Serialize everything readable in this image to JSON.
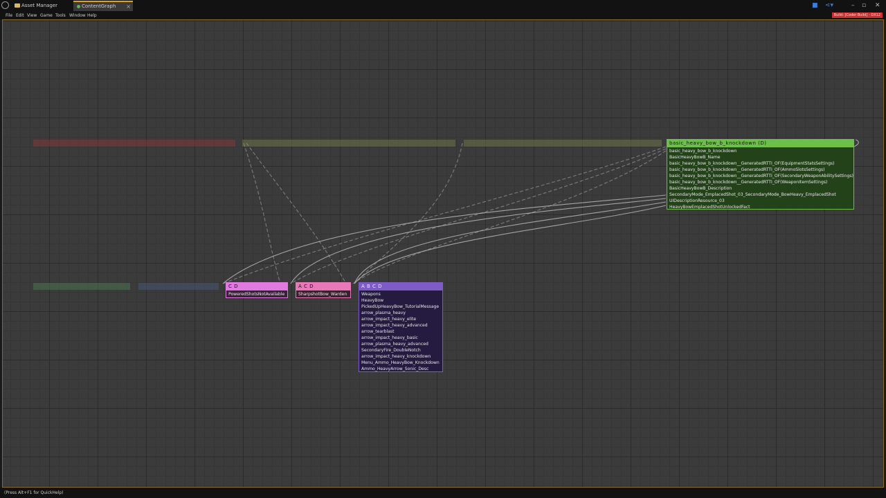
{
  "tabs": [
    {
      "label": "Asset Manager",
      "icon": "folder-icon"
    },
    {
      "label": "ContentGraph",
      "icon": "graph-icon",
      "active": true
    }
  ],
  "menu": [
    "File",
    "Edit",
    "View",
    "Game",
    "Tools",
    "Window",
    "Help"
  ],
  "build_badge": "Build: [Coder Build] - DX12",
  "nodes": {
    "bow": {
      "title": "basic_heavy_bow_b_knockdown (D)",
      "color": "#6cc04a",
      "items": [
        "basic_heavy_bow_b_knockdown",
        "BasicHeavyBowB_Name",
        "basic_heavy_bow_b_knockdown__GeneratedRTTI_OF(EquipmentStatsSettings)",
        "basic_heavy_bow_b_knockdown__GeneratedRTTI_OF(AmmoSlotsSettings)",
        "basic_heavy_bow_b_knockdown__GeneratedRTTI_OF(SecondaryWeaponAbilitySettings)",
        "basic_heavy_bow_b_knockdown__GeneratedRTTI_OF(WeaponItemSettings)",
        "BasicHeavyBowB_Description",
        "SecondaryMode_EmplacedShot_03_SecondaryMode_BowHeavy_EmplacedShot",
        "UIDescriptionResource_03",
        "HeavyBowEmplacedShotUnlockedFact"
      ]
    },
    "cd": {
      "title": "C D",
      "color": "#e07ae0",
      "items": [
        "PoweredShotsNotAvailable"
      ]
    },
    "acd": {
      "title": "A C D",
      "color": "#e878b8",
      "items": [
        "SharpshotBow_Warden"
      ]
    },
    "abcd": {
      "title": "A B C D",
      "color": "#7e5cc8",
      "items": [
        "Weapons",
        "HeavyBow",
        "PickedUpHeavyBow_TutorialMessage",
        "arrow_plasma_heavy",
        "arrow_impact_heavy_elite",
        "arrow_impact_heavy_advanced",
        "arrow_tearblast",
        "arrow_impact_heavy_basic",
        "arrow_plasma_heavy_advanced",
        "SecondaryFire_DoubleNotch",
        "arrow_impact_heavy_knockdown",
        "Menu_Ammo_HeavyBow_Knockdown",
        "Ammo_HeavyArrow_Sonic_Desc"
      ]
    }
  },
  "status": "(Press Alt+F1 for QuickHelp)"
}
